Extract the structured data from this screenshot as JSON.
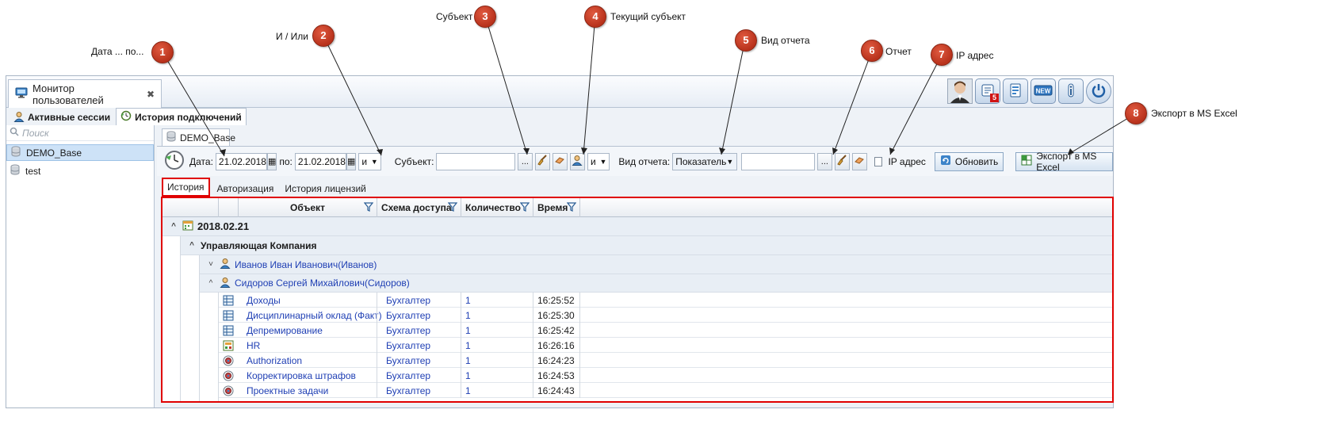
{
  "callouts": [
    {
      "num": "1",
      "label": "Дата  ... по..."
    },
    {
      "num": "2",
      "label": "И / Или"
    },
    {
      "num": "3",
      "label": "Субъект"
    },
    {
      "num": "4",
      "label": "Текущий субъект"
    },
    {
      "num": "5",
      "label": "Вид отчета"
    },
    {
      "num": "6",
      "label": "Отчет"
    },
    {
      "num": "7",
      "label": "IP адрес"
    },
    {
      "num": "8",
      "label": "Экспорт в MS Excel"
    }
  ],
  "window": {
    "title": "Монитор пользователей",
    "notification_count": "5",
    "tools": [
      "avatar",
      "messages-icon",
      "report-icon",
      "news-icon",
      "info-icon",
      "power-icon"
    ]
  },
  "tabs": [
    "Активные сессии",
    "История подключений"
  ],
  "left_panel": {
    "search_placeholder": "Поиск",
    "items": [
      "DEMO_Base",
      "test"
    ]
  },
  "db_tab": "DEMO_Base",
  "filter": {
    "date_label": "Дата:",
    "date_from": "21.02.2018",
    "to_label": "по:",
    "date_to": "21.02.2018",
    "andor_value": "и",
    "subject_label": "Субъект:",
    "subject_value": "",
    "dots": "...",
    "andor_value_2": "и",
    "report_type_label": "Вид отчета:",
    "report_type_value": "Показатель",
    "report_value": "",
    "ip_label": "IP адрес",
    "refresh_label": "Обновить",
    "export_label": "Экспорт в MS Excel"
  },
  "report_tabs": [
    "История",
    "Авторизация",
    "История лицензий"
  ],
  "grid": {
    "columns": [
      "Объект",
      "Схема доступа",
      "Количество",
      "Время"
    ],
    "date_group": "2018.02.21",
    "org_group": "Управляющая Компания",
    "users": [
      "Иванов Иван Иванович(Иванов)",
      "Сидоров Сергей Михайлович(Сидоров)"
    ],
    "rows": [
      {
        "icon": "table-icon",
        "object": "Доходы",
        "scheme": "Бухгалтер",
        "count": "1",
        "time": "16:25:52"
      },
      {
        "icon": "table-icon",
        "object": "Дисциплинарный оклад (Факт)",
        "scheme": "Бухгалтер",
        "count": "1",
        "time": "16:25:30"
      },
      {
        "icon": "table-icon",
        "object": "Депремирование",
        "scheme": "Бухгалтер",
        "count": "1",
        "time": "16:25:42"
      },
      {
        "icon": "hr-icon",
        "object": "HR",
        "scheme": "Бухгалтер",
        "count": "1",
        "time": "16:26:16"
      },
      {
        "icon": "process-icon",
        "object": "Authorization",
        "scheme": "Бухгалтер",
        "count": "1",
        "time": "16:24:23"
      },
      {
        "icon": "process-icon",
        "object": "Корректировка штрафов",
        "scheme": "Бухгалтер",
        "count": "1",
        "time": "16:24:53"
      },
      {
        "icon": "process-icon",
        "object": "Проектные задачи",
        "scheme": "Бухгалтер",
        "count": "1",
        "time": "16:24:43"
      }
    ]
  }
}
